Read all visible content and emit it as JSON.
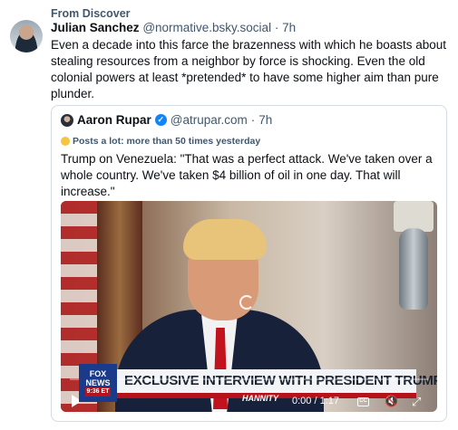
{
  "feed": {
    "source_label": "From Discover"
  },
  "post": {
    "author_name": "Julian Sanchez",
    "author_handle": "@normative.bsky.social",
    "separator": " · ",
    "time": "7h",
    "text": "Even a decade into this farce the brazenness with which he boasts about stealing resources from a neighbor by force is shocking. Even the old colonial powers at least *pretended* to have some higher aim than pure plunder."
  },
  "quote": {
    "author_name": "Aaron Rupar",
    "author_handle": "@atrupar.com",
    "separator": "·",
    "time": "7h",
    "label": "Posts a lot: more than 50 times yesterday",
    "text": "Trump on Venezuela: \"That was a perfect attack. We've taken over a whole country. We've taken $4 billion of oil in one day. That will increase.\"",
    "video": {
      "chyron": "EXCLUSIVE INTERVIEW WITH PRESIDENT TRUMP",
      "network_top": "FOX",
      "network_bottom": "NEWS",
      "network_time": "9:36 ET",
      "show": "HANNITY",
      "timestamp": "0:00 / 1:17",
      "progress": 0
    }
  },
  "colors": {
    "accent": "#1083fe",
    "muted": "#42576c",
    "border": "#d4dbe2"
  },
  "icons": [
    "play-icon",
    "cc-icon",
    "mute-icon",
    "fullscreen-icon",
    "verified-badge-icon",
    "loading-spinner-icon"
  ]
}
